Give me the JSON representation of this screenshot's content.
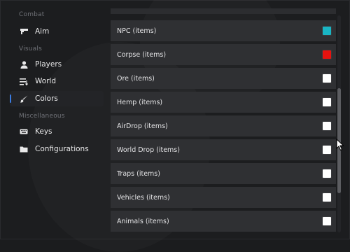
{
  "sidebar": {
    "sections": [
      {
        "title": "Combat"
      },
      {
        "title": "Visuals"
      },
      {
        "title": "Miscellaneous"
      }
    ],
    "items": [
      {
        "label": "Aim",
        "icon": "gun-icon"
      },
      {
        "label": "Players",
        "icon": "person-icon"
      },
      {
        "label": "World",
        "icon": "list-icon"
      },
      {
        "label": "Colors",
        "icon": "brush-icon",
        "active": true
      },
      {
        "label": "Keys",
        "icon": "keyboard-icon"
      },
      {
        "label": "Configurations",
        "icon": "folder-icon"
      }
    ]
  },
  "colors": {
    "rows": [
      {
        "label": "NPC (items)",
        "swatch": "#19b5c4"
      },
      {
        "label": "Corpse (items)",
        "swatch": "#e8120f"
      },
      {
        "label": "Ore (items)",
        "swatch": "#ffffff"
      },
      {
        "label": "Hemp (items)",
        "swatch": "#ffffff"
      },
      {
        "label": "AirDrop (items)",
        "swatch": "#ffffff"
      },
      {
        "label": "World Drop (items)",
        "swatch": "#ffffff"
      },
      {
        "label": "Traps (items)",
        "swatch": "#ffffff"
      },
      {
        "label": "Vehicles (items)",
        "swatch": "#ffffff"
      },
      {
        "label": "Animals (items)",
        "swatch": "#ffffff"
      }
    ]
  },
  "theme": {
    "accent": "#3a7be0"
  }
}
